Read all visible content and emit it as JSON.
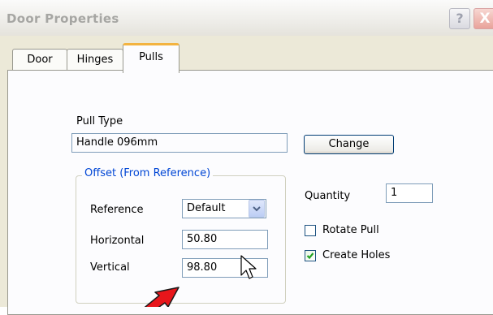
{
  "window": {
    "title": "Door Properties",
    "help_label": "?",
    "close_label": "X"
  },
  "tabs": [
    {
      "label": "Door",
      "active": false
    },
    {
      "label": "Hinges",
      "active": false
    },
    {
      "label": "Pulls",
      "active": true
    }
  ],
  "pull_type": {
    "label": "Pull Type",
    "value": "Handle 096mm",
    "change_button": "Change"
  },
  "offset": {
    "group_title": "Offset (From Reference)",
    "reference_label": "Reference",
    "reference_value": "Default",
    "horizontal_label": "Horizontal",
    "horizontal_value": "50.80",
    "vertical_label": "Vertical",
    "vertical_value": "98.80"
  },
  "quantity": {
    "label": "Quantity",
    "value": "1"
  },
  "options": {
    "rotate_pull": {
      "label": "Rotate Pull",
      "checked": false
    },
    "create_holes": {
      "label": "Create Holes",
      "checked": true
    }
  },
  "colors": {
    "dialog_bg": "#ece9d8",
    "panel_bg": "#fcfcfe",
    "group_title": "#0046d5",
    "active_tab_accent": "#f3b340",
    "annotation_arrow": "#e8161b"
  },
  "icons": [
    "help-icon",
    "close-icon",
    "dropdown-arrow-icon",
    "checkmark-icon",
    "mouse-pointer-icon",
    "annotation-arrow-icon"
  ]
}
